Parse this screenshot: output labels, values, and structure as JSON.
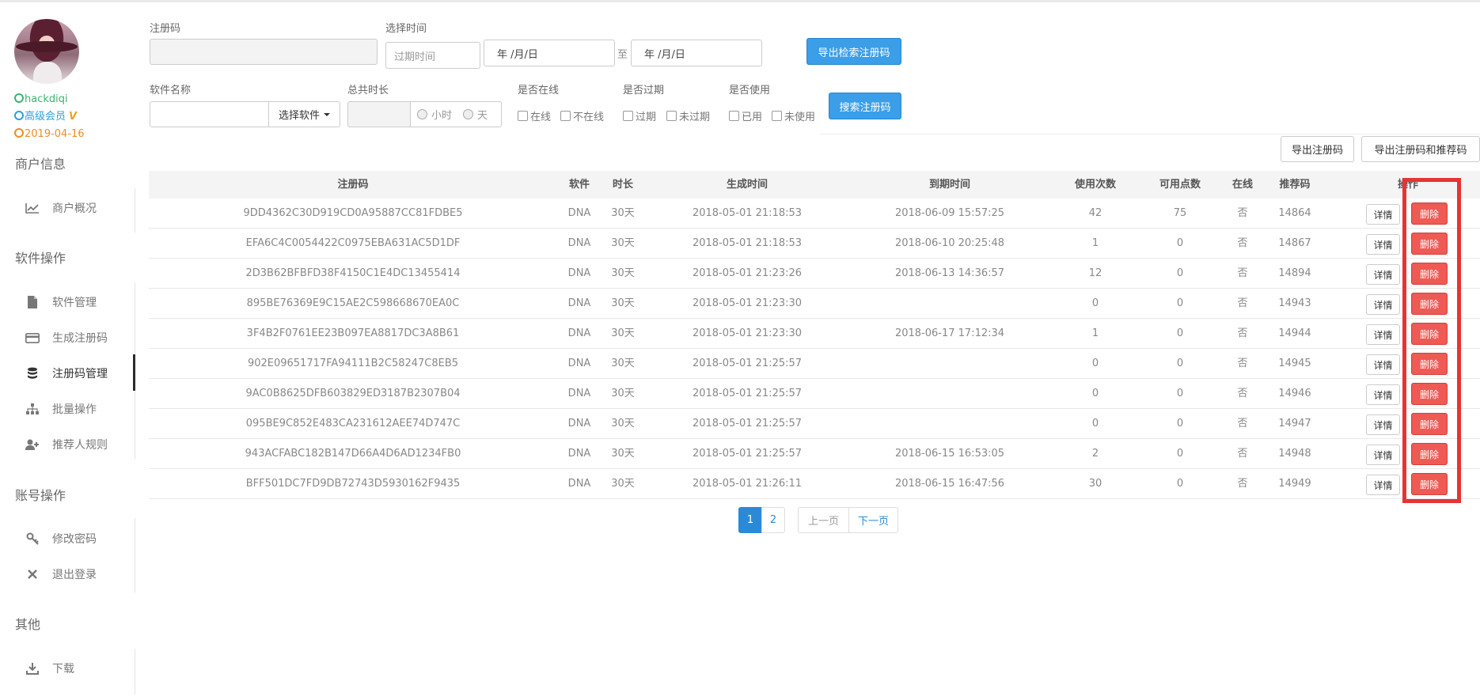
{
  "user": {
    "name": "hackdiqi",
    "level": "高级会员",
    "vip_mark": "V",
    "expire": "2019-04-16"
  },
  "sidebar": {
    "sections": [
      {
        "title": "商户信息",
        "items": [
          {
            "label": "商户概况",
            "icon": "chart-icon"
          }
        ]
      },
      {
        "title": "软件操作",
        "items": [
          {
            "label": "软件管理",
            "icon": "file-icon"
          },
          {
            "label": "生成注册码",
            "icon": "card-icon"
          },
          {
            "label": "注册码管理",
            "icon": "database-icon",
            "active": true
          },
          {
            "label": "批量操作",
            "icon": "sitemap-icon"
          },
          {
            "label": "推荐人规则",
            "icon": "user-add-icon"
          }
        ]
      },
      {
        "title": "账号操作",
        "items": [
          {
            "label": "修改密码",
            "icon": "key-icon"
          },
          {
            "label": "退出登录",
            "icon": "close-icon"
          }
        ]
      },
      {
        "title": "其他",
        "items": [
          {
            "label": "下载",
            "icon": "download-icon"
          }
        ]
      }
    ]
  },
  "filters": {
    "code_label": "注册码",
    "code_value": "",
    "time_label": "选择时间",
    "time_type_placeholder": "过期时间",
    "date_from": "年 /月/日",
    "date_to_sep": "至",
    "date_to": "年 /月/日",
    "export_search_btn": "导出检索注册码",
    "software_label": "软件名称",
    "software_value": "",
    "choose_software_btn": "选择软件",
    "duration_label": "总共时长",
    "duration_value": "",
    "unit_hour": "小时",
    "unit_day": "天",
    "online_label": "是否在线",
    "online_opts": [
      "在线",
      "不在线"
    ],
    "expired_label": "是否过期",
    "expired_opts": [
      "过期",
      "未过期"
    ],
    "used_label": "是否使用",
    "used_opts": [
      "已用",
      "未使用"
    ],
    "search_btn": "搜索注册码"
  },
  "toolbar": {
    "export_codes": "导出注册码",
    "export_codes_ref": "导出注册码和推荐码"
  },
  "table": {
    "columns": [
      "注册码",
      "软件",
      "时长",
      "生成时间",
      "到期时间",
      "使用次数",
      "可用点数",
      "在线",
      "推荐码",
      "操作"
    ],
    "detail_label": "详情",
    "delete_label": "删除",
    "rows": [
      {
        "code": "9DD4362C30D919CD0A95887CC81FDBE5",
        "software": "DNA",
        "duration": "30天",
        "created": "2018-05-01 21:18:53",
        "expires": "2018-06-09 15:57:25",
        "uses": "42",
        "points": "75",
        "online": "否",
        "ref": "14864"
      },
      {
        "code": "EFA6C4C0054422C0975EBA631AC5D1DF",
        "software": "DNA",
        "duration": "30天",
        "created": "2018-05-01 21:18:53",
        "expires": "2018-06-10 20:25:48",
        "uses": "1",
        "points": "0",
        "online": "否",
        "ref": "14867"
      },
      {
        "code": "2D3B62BFBFD38F4150C1E4DC13455414",
        "software": "DNA",
        "duration": "30天",
        "created": "2018-05-01 21:23:26",
        "expires": "2018-06-13 14:36:57",
        "uses": "12",
        "points": "0",
        "online": "否",
        "ref": "14894"
      },
      {
        "code": "895BE76369E9C15AE2C598668670EA0C",
        "software": "DNA",
        "duration": "30天",
        "created": "2018-05-01 21:23:30",
        "expires": "",
        "uses": "0",
        "points": "0",
        "online": "否",
        "ref": "14943"
      },
      {
        "code": "3F4B2F0761EE23B097EA8817DC3A8B61",
        "software": "DNA",
        "duration": "30天",
        "created": "2018-05-01 21:23:30",
        "expires": "2018-06-17 17:12:34",
        "uses": "1",
        "points": "0",
        "online": "否",
        "ref": "14944"
      },
      {
        "code": "902E09651717FA94111B2C58247C8EB5",
        "software": "DNA",
        "duration": "30天",
        "created": "2018-05-01 21:25:57",
        "expires": "",
        "uses": "0",
        "points": "0",
        "online": "否",
        "ref": "14945"
      },
      {
        "code": "9AC0B8625DFB603829ED3187B2307B04",
        "software": "DNA",
        "duration": "30天",
        "created": "2018-05-01 21:25:57",
        "expires": "",
        "uses": "0",
        "points": "0",
        "online": "否",
        "ref": "14946"
      },
      {
        "code": "095BE9C852E483CA231612AEE74D747C",
        "software": "DNA",
        "duration": "30天",
        "created": "2018-05-01 21:25:57",
        "expires": "",
        "uses": "0",
        "points": "0",
        "online": "否",
        "ref": "14947"
      },
      {
        "code": "943ACFABC182B147D66A4D6AD1234FB0",
        "software": "DNA",
        "duration": "30天",
        "created": "2018-05-01 21:25:57",
        "expires": "2018-06-15 16:53:05",
        "uses": "2",
        "points": "0",
        "online": "否",
        "ref": "14948"
      },
      {
        "code": "BFF501DC7FD9DB72743D5930162F9435",
        "software": "DNA",
        "duration": "30天",
        "created": "2018-05-01 21:26:11",
        "expires": "2018-06-15 16:47:56",
        "uses": "30",
        "points": "0",
        "online": "否",
        "ref": "14949"
      }
    ]
  },
  "pagination": {
    "pages": [
      "1",
      "2"
    ],
    "current": "1",
    "prev": "上一页",
    "next": "下一页"
  },
  "colors": {
    "primary": "#3a9ee8",
    "danger": "#ee5a54",
    "highlight_box": "#e83333"
  }
}
